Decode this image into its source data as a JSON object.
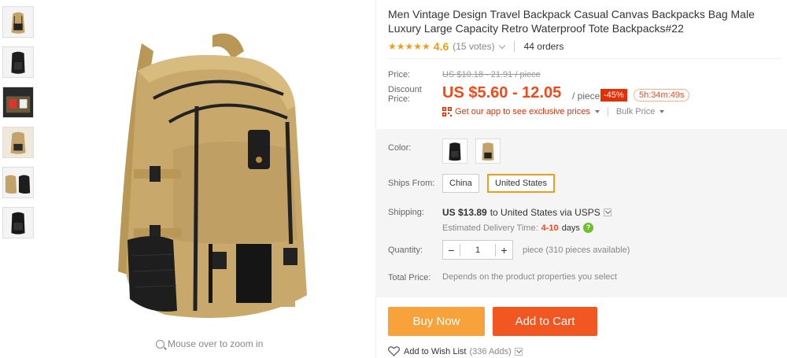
{
  "gallery": {
    "zoom_hint": "Mouse over to zoom in"
  },
  "product": {
    "title": "Men Vintage Design Travel Backpack Casual Canvas Backpacks Bag Male Luxury Large Capacity Retro Waterproof Tote Backpacks#22",
    "stars": "★★★★★",
    "rating": "4.6",
    "votes": "(15 votes)",
    "orders": "44 orders"
  },
  "pricing": {
    "price_label": "Price:",
    "original_price": "US $10.18 - 21.91 / piece",
    "discount_label_1": "Discount",
    "discount_label_2": "Price:",
    "discount_price": "US $5.60 - 12.05",
    "unit": "/ piece",
    "discount_badge": "-45%",
    "countdown": "5h:34m:49s",
    "app_promo": "Get our app to see exclusive prices",
    "bulk_price": "Bulk Price"
  },
  "options": {
    "color_label": "Color:",
    "ships_from_label": "Ships From:",
    "ships_from": [
      "China",
      "United States"
    ],
    "ships_from_selected": "United States"
  },
  "shipping": {
    "label": "Shipping:",
    "cost": "US $13.89",
    "to": "to United States via USPS",
    "delivery_label": "Estimated Delivery Time:",
    "delivery_days": "4-10",
    "days_word": "days"
  },
  "quantity": {
    "label": "Quantity:",
    "value": "1",
    "minus": "−",
    "plus": "+",
    "available": "piece (310 pieces available)"
  },
  "total": {
    "label": "Total Price:",
    "text": "Depends on the product properties you select"
  },
  "actions": {
    "buy_now": "Buy Now",
    "add_to_cart": "Add to Cart",
    "wish_list": "Add to Wish List",
    "wish_count": "(336 Adds)"
  },
  "colors": {
    "price_red": "#f04a1a",
    "buy_now_bg": "#f7a23a",
    "add_to_cart_bg": "#f25722",
    "star": "#f29d1a",
    "selected_border": "#f29d1a"
  }
}
